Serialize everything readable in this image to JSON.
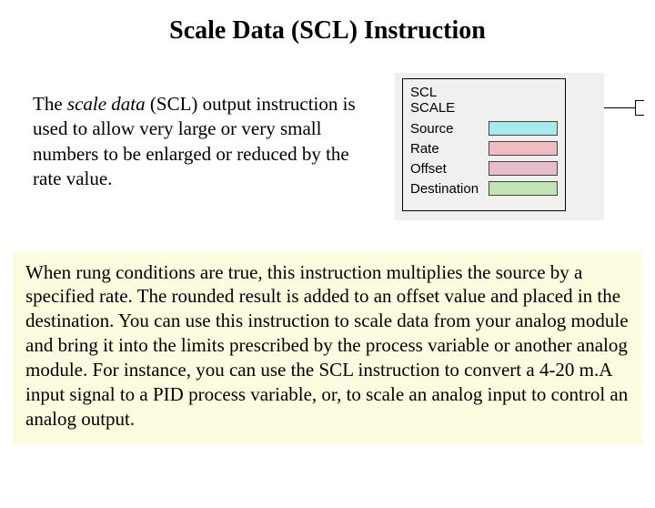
{
  "title": "Scale Data (SCL) Instruction",
  "intro": {
    "prefix": "The ",
    "italic": "scale data",
    "rest": " (SCL) output instruction is used to allow very large or very small numbers to be enlarged or reduced by the rate value."
  },
  "diagram": {
    "mnemonic": "SCL",
    "name": "SCALE",
    "rows": {
      "source": "Source",
      "rate": "Rate",
      "offset": "Offset",
      "destination": "Destination"
    }
  },
  "description": "When rung conditions are true, this instruction multiplies the source by a specified rate.  The rounded result is added to an offset value and placed in the destination. You can use this instruction to scale data from your analog module and bring it into the limits prescribed by the process variable or another analog module.  For instance, you can use the SCL instruction to convert a 4-20 m.A input signal to a PID process variable, or, to scale an analog input to control an analog output."
}
